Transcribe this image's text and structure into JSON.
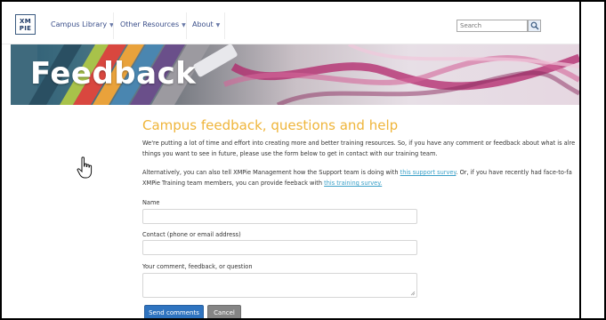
{
  "colors": {
    "heading": "#efb53a",
    "link": "#3aa0c8",
    "nav_text": "#3b4f8a",
    "primary_button": "#2f74c0",
    "secondary_button": "#858585"
  },
  "header": {
    "logo_line1": "XM",
    "logo_line2": "PIE",
    "nav": [
      {
        "label": "Campus Library",
        "icon": "chevron-down-icon"
      },
      {
        "label": "Other Resources",
        "icon": "chevron-down-icon"
      },
      {
        "label": "About",
        "icon": "chevron-down-icon"
      }
    ],
    "search": {
      "placeholder": "Search",
      "value": "",
      "icon": "search-icon"
    }
  },
  "banner": {
    "title": "Feedback"
  },
  "main": {
    "heading": "Campus feedback, questions and help",
    "intro_line1": "We're putting a lot of time and effort into creating more and better training resources. So, if you have any comment or feedback about what is alre",
    "intro_line2": "things you want to see in future, please use the form below to get in contact with our training team.",
    "alt_line1_pre": "Alternatively, you can also tell XMPie Management how the Support team is doing with",
    "alt_link1": "this support survey",
    "alt_line1_post": ". Or, if you have recently had face-to-fa",
    "alt_line2_pre": "XMPie Training team members, you can provide feeback with",
    "alt_link2": "this training survey."
  },
  "form": {
    "name_label": "Name",
    "name_value": "",
    "contact_label": "Contact (phone or email address)",
    "contact_value": "",
    "comment_label": "Your comment, feedback, or question",
    "comment_value": "",
    "send_button": "Send comments",
    "cancel_button": "Cancel"
  },
  "cursor": {
    "icon": "hand-pointer-icon"
  }
}
